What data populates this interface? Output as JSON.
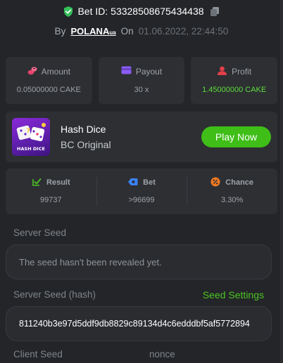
{
  "header": {
    "bet_id_label": "Bet ID: 53328508675434438",
    "by_label": "By",
    "username": "POLANA",
    "username_suffix": "ua",
    "on_label": "On",
    "date": "01.06.2022, 22:44:50"
  },
  "stats": {
    "amount": {
      "label": "Amount",
      "value": "0.05000000 CAKE"
    },
    "payout": {
      "label": "Payout",
      "value": "30 x"
    },
    "profit": {
      "label": "Profit",
      "value": "1.45000000 CAKE"
    }
  },
  "game": {
    "title": "Hash Dice",
    "subtitle": "BC Original",
    "thumb_text": "HASH DICE",
    "play_label": "Play Now"
  },
  "result": {
    "result": {
      "label": "Result",
      "value": "99737"
    },
    "bet": {
      "label": "Bet",
      "value": ">96699"
    },
    "chance": {
      "label": "Chance",
      "value": "3.30%"
    }
  },
  "seeds": {
    "server_seed_label": "Server Seed",
    "server_seed_value": "The seed hasn't been revealed yet.",
    "server_seed_hash_label": "Server Seed (hash)",
    "seed_settings_label": "Seed Settings",
    "server_seed_hash_value": "811240b3e97d5ddf9db8829c89134d4c6edddbf5af5772894",
    "client_seed_label": "Client Seed",
    "nonce_label": "nonce"
  },
  "colors": {
    "background": "#232528",
    "card": "#2d2f33",
    "accent_green": "#3fbe18",
    "profit_green": "#5ddc3a",
    "amount_icon": "#e8436d",
    "payout_icon": "#8b5cf6",
    "profit_icon": "#e2404a",
    "result_icon": "#4cc424",
    "bet_icon": "#3b82f6",
    "chance_icon": "#f07a22"
  },
  "icons": {
    "shield": "shield-check-icon",
    "copy": "copy-icon",
    "amount": "coins-icon",
    "payout": "wallet-card-icon",
    "profit": "user-coins-icon",
    "result": "checkbox-result-icon",
    "bet": "bet-tag-icon",
    "chance": "percent-icon"
  }
}
